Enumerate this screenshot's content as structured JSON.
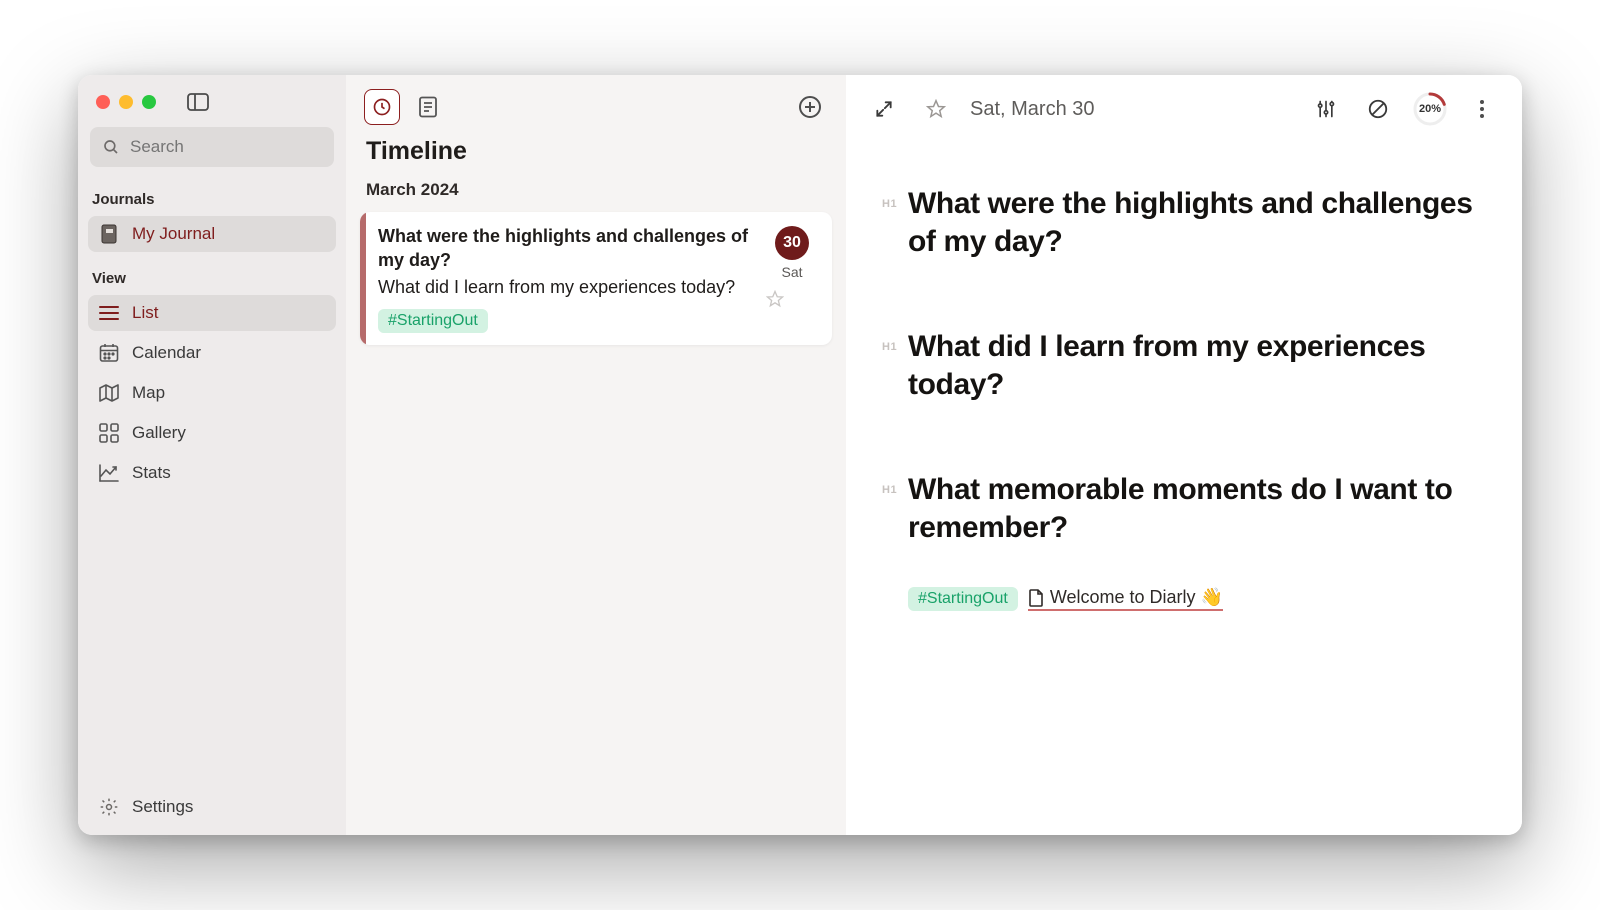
{
  "sidebar": {
    "search_placeholder": "Search",
    "sections": {
      "journals_label": "Journals",
      "view_label": "View"
    },
    "journal_item": "My Journal",
    "view_items": {
      "list": "List",
      "calendar": "Calendar",
      "map": "Map",
      "gallery": "Gallery",
      "stats": "Stats"
    },
    "settings": "Settings"
  },
  "timeline": {
    "heading": "Timeline",
    "month": "March 2024",
    "entry": {
      "line1": "What were the highlights and challenges of my day?",
      "line2": "What did I learn from my experiences today?",
      "tag": "#StartingOut",
      "date_num": "30",
      "day_abbr": "Sat"
    }
  },
  "editor": {
    "date_label": "Sat, March 30",
    "progress_pct": "20%",
    "prompts": [
      "What were the highlights and challenges of my day?",
      "What did I learn from my experiences today?",
      "What memorable moments do I want to remember?"
    ],
    "tag": "#StartingOut",
    "link_label": "Welcome to Diarly 👋"
  }
}
